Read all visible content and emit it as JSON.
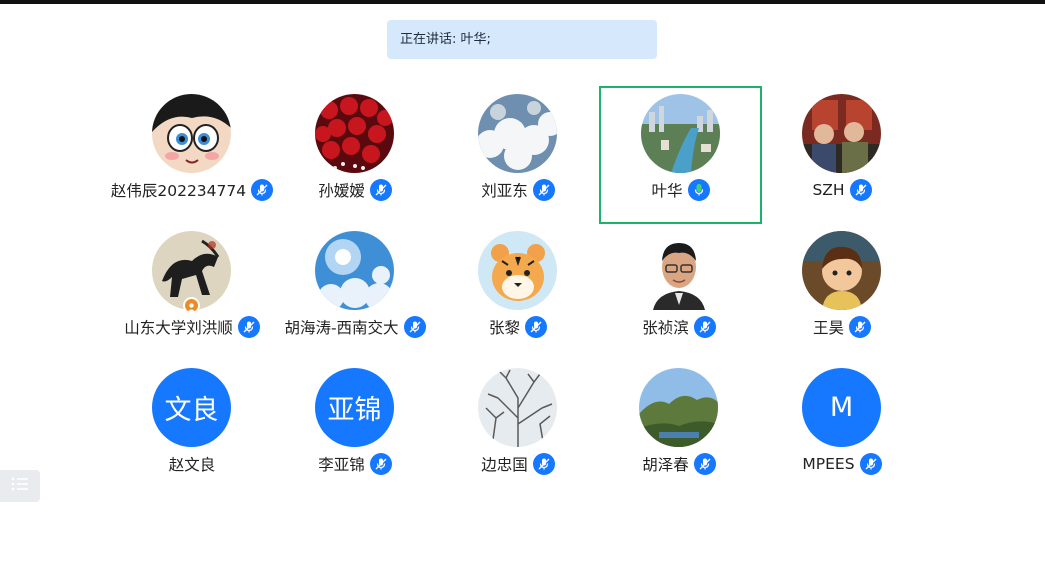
{
  "banner": {
    "text": "正在讲话: 叶华;"
  },
  "accent_color": "#1677ff",
  "active_speaker_border": "#19b36b",
  "participants": [
    {
      "name": "赵伟辰202234774",
      "avatar": "cartoon-face-photo",
      "mic": "mic-icon"
    },
    {
      "name": "孙嫒嫒",
      "avatar": "red-roses-photo",
      "mic": "mic-icon"
    },
    {
      "name": "刘亚东",
      "avatar": "clouds-photo",
      "mic": "mic-icon"
    },
    {
      "name": "叶华",
      "avatar": "city-river-photo",
      "mic": "mic-active-icon",
      "speaking": true
    },
    {
      "name": "SZH",
      "avatar": "people-photo",
      "mic": "mic-icon"
    },
    {
      "name": "山东大学刘洪顺",
      "avatar": "horse-painting-photo",
      "mic": "mic-icon",
      "host_badge": "host-icon"
    },
    {
      "name": "胡海涛-西南交大",
      "avatar": "sun-sky-photo",
      "mic": "mic-icon"
    },
    {
      "name": "张黎",
      "avatar": "tiger-cartoon-photo",
      "mic": "mic-icon"
    },
    {
      "name": "张祯滨",
      "avatar": "man-portrait-photo",
      "mic": "mic-icon"
    },
    {
      "name": "王昊",
      "avatar": "anime-boy-photo",
      "mic": "mic-icon"
    },
    {
      "name": "赵文良",
      "avatar_initials": "文良"
    },
    {
      "name": "李亚锦",
      "avatar_initials": "亚锦",
      "mic": "mic-icon"
    },
    {
      "name": "边忠国",
      "avatar": "bare-trees-photo",
      "mic": "mic-icon"
    },
    {
      "name": "胡泽春",
      "avatar": "mountain-landscape-photo",
      "mic": "mic-icon"
    },
    {
      "name": "MPEES",
      "avatar_initials": "M",
      "mic": "mic-icon"
    }
  ],
  "menu_button": {
    "icon": "list-icon"
  }
}
